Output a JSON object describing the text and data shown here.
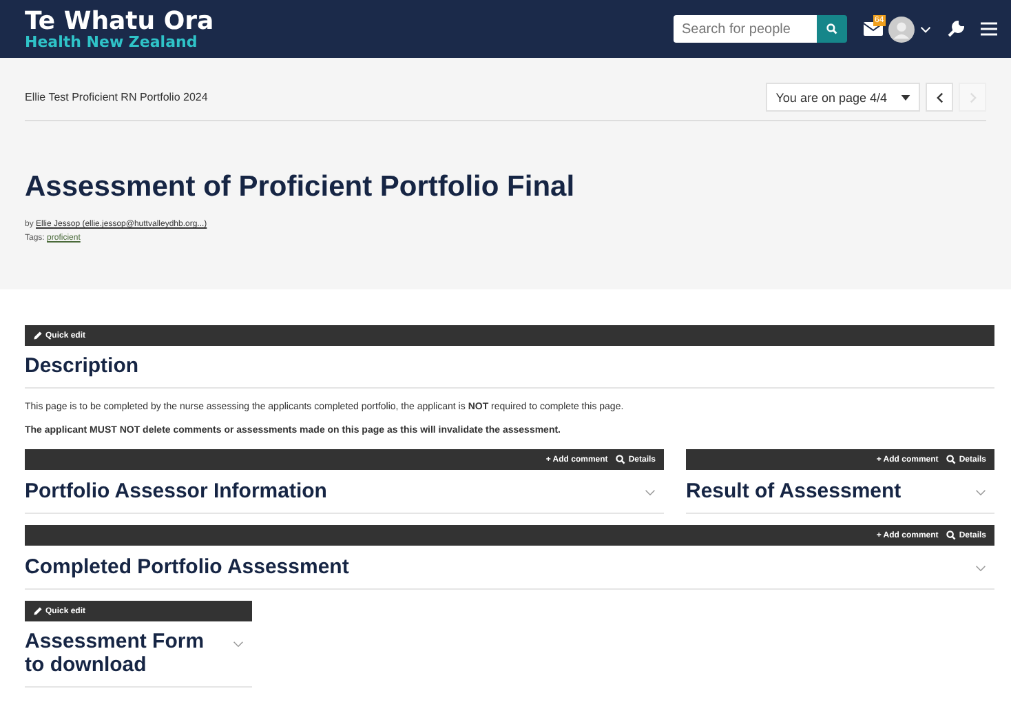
{
  "header": {
    "logo_title": "Te Whatu Ora",
    "logo_subtitle": "Health New Zealand",
    "search": {
      "placeholder": "Search for people"
    },
    "mail_badge": "64"
  },
  "breadcrumb": "Ellie Test Proficient RN Portfolio 2024",
  "pager": {
    "label": "You are on page 4/4",
    "prev": {
      "disabled": false
    },
    "next": {
      "disabled": true
    }
  },
  "page": {
    "title": "Assessment of Proficient Portfolio Final",
    "by_label": "by",
    "author": "Ellie Jessop (ellie.jessop@huttvalleydhb.org...)",
    "tags_label": "Tags:",
    "tag": "proficient"
  },
  "description": {
    "toolbar": {
      "kind": "quickedit",
      "quick_edit": "Quick edit"
    },
    "heading": "Description",
    "paragraphs": [
      {
        "text": "This page is to be completed by the nurse assessing the applicants completed portfolio, the applicant is **NOT** required to complete this page.",
        "bold": false
      },
      {
        "text": "The applicant MUST NOT delete comments or assessments made on this page as this will invalidate the assessment.",
        "bold": true
      }
    ]
  },
  "rows": [
    [
      {
        "toolbar": {
          "kind": "comment",
          "add_comment": "+ Add comment",
          "details": "Details"
        },
        "heading": "Portfolio Assessor Information",
        "expanded": false
      },
      {
        "toolbar": {
          "kind": "comment",
          "add_comment": "+ Add comment",
          "details": "Details"
        },
        "heading": "Result of Assessment",
        "expanded": false
      }
    ],
    [
      {
        "toolbar": {
          "kind": "comment",
          "add_comment": "+ Add comment",
          "details": "Details"
        },
        "heading": "Completed Portfolio Assessment",
        "expanded": false
      }
    ],
    [
      {
        "toolbar": {
          "kind": "quickedit",
          "quick_edit": "Quick edit"
        },
        "heading": "Assessment Form to download",
        "expanded": false,
        "narrow": true
      }
    ]
  ]
}
